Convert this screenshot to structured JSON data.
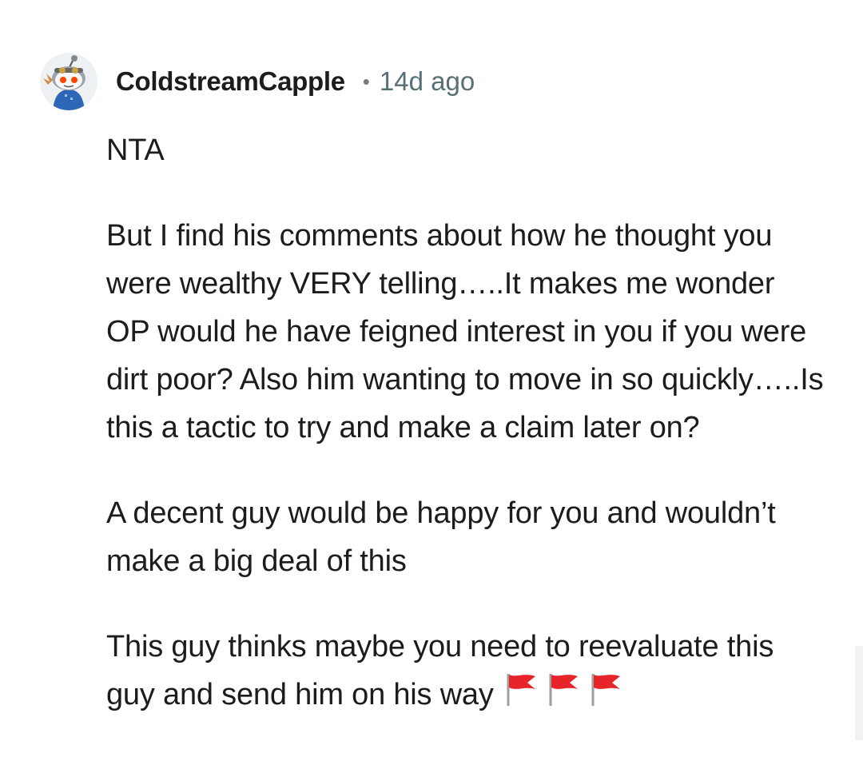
{
  "comment": {
    "author": "ColdstreamCapple",
    "separator": "•",
    "timestamp": "14d ago",
    "avatar_icon": "snoo-avatar-icon",
    "paragraphs": [
      "NTA",
      "But I find his comments about how he thought you were wealthy VERY telling…..It makes me wonder OP would he have feigned interest in you if you were dirt poor? Also him wanting to move in so quickly…..Is this a tactic to try and make a claim later on?",
      "A decent guy would be happy for you and wouldn’t make a big deal of this",
      "This guy thinks maybe you need to reevaluate this guy and send him on his way"
    ],
    "trailing_emoji": [
      "red-flag-icon",
      "red-flag-icon",
      "red-flag-icon"
    ]
  },
  "colors": {
    "author": "#1c1c1c",
    "meta": "#576f76",
    "body_text": "#1c1c1c",
    "flag": "#e8242b"
  }
}
